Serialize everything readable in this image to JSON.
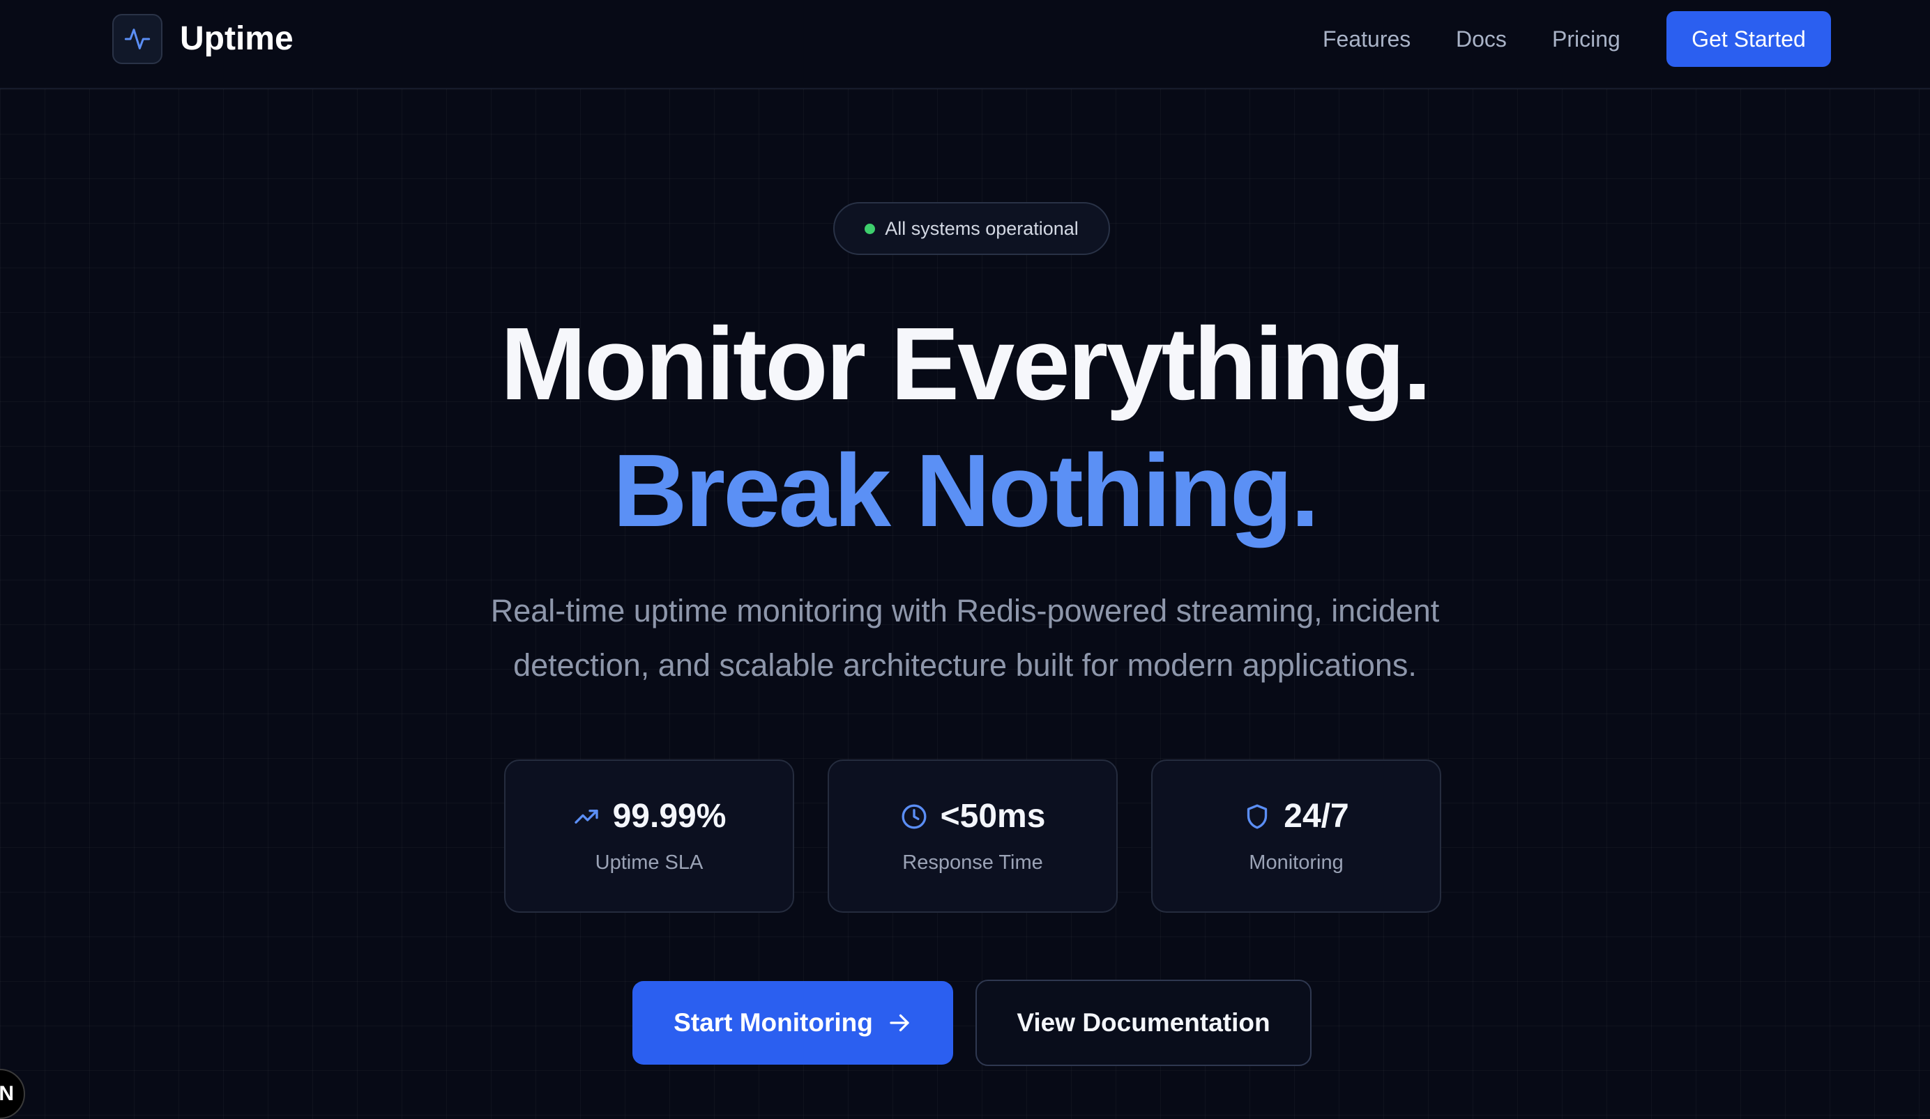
{
  "header": {
    "brand": "Uptime",
    "nav": {
      "features": "Features",
      "docs": "Docs",
      "pricing": "Pricing"
    },
    "cta": "Get Started"
  },
  "hero": {
    "status_badge": "All systems operational",
    "headline_line1": "Monitor Everything.",
    "headline_line2": "Break Nothing.",
    "subtitle": "Real-time uptime monitoring with Redis-powered streaming, incident detection, and scalable architecture built for modern applications."
  },
  "stats": [
    {
      "icon": "trending-up-icon",
      "value": "99.99%",
      "label": "Uptime SLA"
    },
    {
      "icon": "clock-icon",
      "value": "<50ms",
      "label": "Response Time"
    },
    {
      "icon": "shield-icon",
      "value": "24/7",
      "label": "Monitoring"
    }
  ],
  "actions": {
    "primary": "Start Monitoring",
    "secondary": "View Documentation"
  },
  "dev_indicator": "N",
  "colors": {
    "background": "#070a16",
    "accent": "#2b5ff0",
    "headline_accent": "#5b90f5",
    "status_green": "#3ecf6d"
  }
}
